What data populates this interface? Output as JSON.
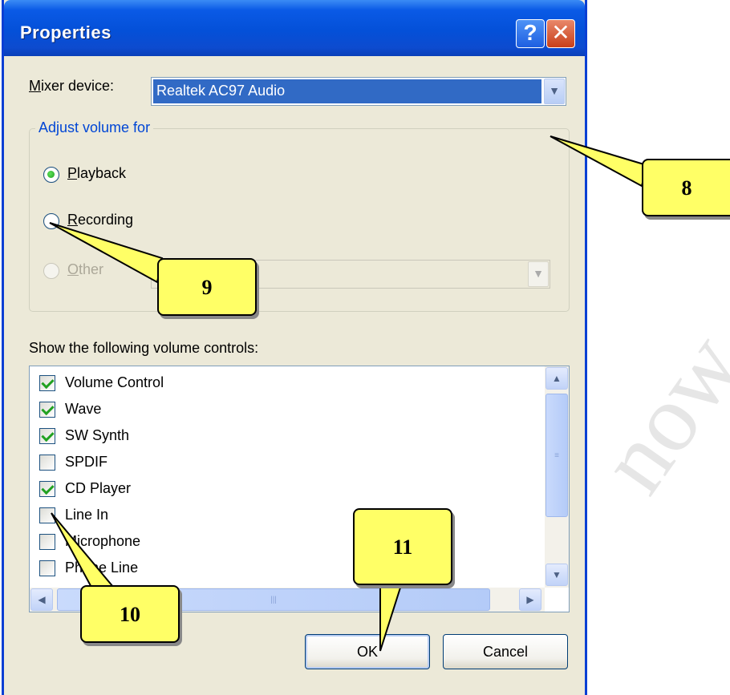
{
  "window": {
    "title": "Properties",
    "help_glyph": "?",
    "close_glyph": "✕"
  },
  "mixer": {
    "label_accel": "M",
    "label_rest": "ixer device:",
    "value": "Realtek AC97 Audio"
  },
  "adjust": {
    "title": "Adjust volume for",
    "options": [
      {
        "accel": "P",
        "rest": "layback",
        "checked": true,
        "enabled": true
      },
      {
        "accel": "R",
        "rest": "ecording",
        "checked": false,
        "enabled": true
      },
      {
        "accel": "O",
        "rest": "ther",
        "checked": false,
        "enabled": false
      }
    ]
  },
  "controls": {
    "label": "Show the following volume controls:",
    "items": [
      {
        "label": "Volume Control",
        "checked": true
      },
      {
        "label": "Wave",
        "checked": true
      },
      {
        "label": "SW Synth",
        "checked": true
      },
      {
        "label": "SPDIF",
        "checked": false
      },
      {
        "label": "CD Player",
        "checked": true
      },
      {
        "label": "Line In",
        "checked": false
      },
      {
        "label": "Microphone",
        "checked": false
      },
      {
        "label": "Phone Line",
        "checked": false
      }
    ]
  },
  "buttons": {
    "ok": "OK",
    "cancel": "Cancel"
  },
  "callouts": {
    "c8": "8",
    "c9": "9",
    "c10": "10",
    "c11": "11"
  },
  "colors": {
    "title_bar": "#0450d8",
    "selection": "#316ac5",
    "callout_fill": "#ffff66",
    "check_green": "#21a121"
  }
}
